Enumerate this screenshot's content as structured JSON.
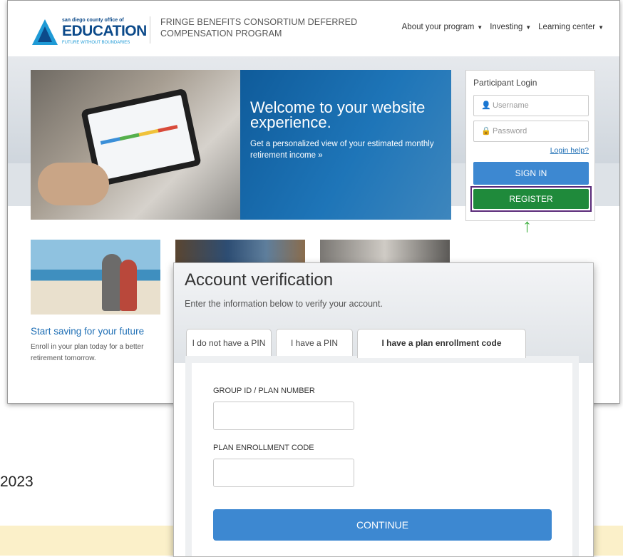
{
  "background": {
    "year_text": "2023"
  },
  "header": {
    "logo_line1": "san diego county office of",
    "logo_line2": "EDUCATION",
    "logo_line3": "FUTURE WITHOUT BOUNDARIES",
    "title_line1": "FRINGE BENEFITS CONSORTIUM DEFERRED",
    "title_line2": "COMPENSATION PROGRAM",
    "nav": [
      {
        "label": "About your program"
      },
      {
        "label": "Investing"
      },
      {
        "label": "Learning center"
      }
    ]
  },
  "hero": {
    "heading": "Welcome to your website experience.",
    "text": "Get a personalized view of your estimated monthly retirement income »"
  },
  "login": {
    "title": "Participant Login",
    "username_placeholder": "Username",
    "password_placeholder": "Password",
    "help_link": "Login help?",
    "signin_label": "SIGN IN",
    "register_label": "REGISTER"
  },
  "card1": {
    "title": "Start saving for your future",
    "text": "Enroll in your plan today for a better retirement tomorrow."
  },
  "modal": {
    "title": "Account verification",
    "subtitle": "Enter the information below to verify your account.",
    "tabs": [
      {
        "label": "I do not have a PIN"
      },
      {
        "label": "I have a PIN"
      },
      {
        "label": "I have a plan enrollment code"
      }
    ],
    "field1_label": "GROUP ID / PLAN NUMBER",
    "field2_label": "PLAN ENROLLMENT CODE",
    "continue_label": "CONTINUE"
  },
  "colors": {
    "brand_blue": "#3d88d1",
    "register_green": "#1f8a3b",
    "highlight_purple": "#5b2b7a",
    "arrow_green": "#3bae3b"
  }
}
